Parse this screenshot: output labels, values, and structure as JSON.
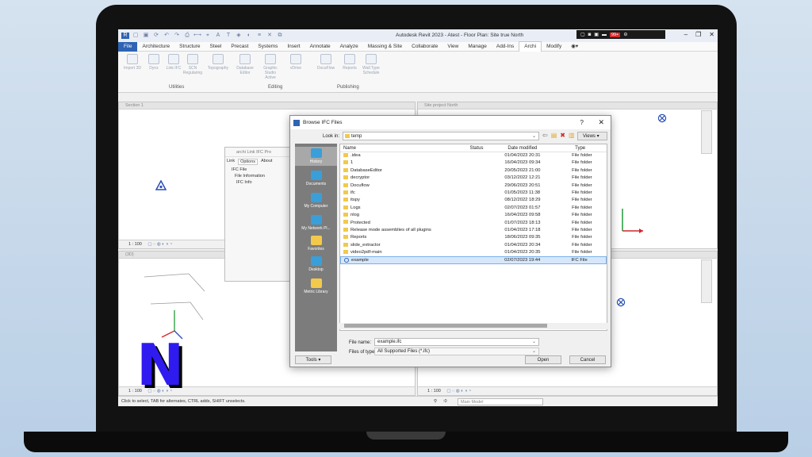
{
  "titlebar": {
    "app_title": "Autodesk Revit 2023 - Atest - Floor Plan: Site true North",
    "overlay_badge": "99+",
    "qat_icons": [
      "revit-logo-icon",
      "open-icon",
      "save-icon",
      "sync-icon",
      "undo-icon",
      "redo-icon",
      "print-icon",
      "measure-icon",
      "dimension-icon",
      "tag-icon",
      "text-icon",
      "3d-icon",
      "section-icon",
      "thin-lines-icon",
      "close-hidden-icon",
      "switch-windows-icon"
    ]
  },
  "ribbon_tabs": [
    "File",
    "Architecture",
    "Structure",
    "Steel",
    "Precast",
    "Systems",
    "Insert",
    "Annotate",
    "Analyze",
    "Massing & Site",
    "Collaborate",
    "View",
    "Manage",
    "Add-Ins",
    "Archi",
    "Modify"
  ],
  "ribbon": {
    "buttons": [
      "Import 3D",
      "Dynz",
      "Link IFC",
      "SCN Regularing",
      "Topography",
      "Database Editor",
      "Graphic Studio Active",
      "vDrive",
      "DocuFlow",
      "Reports",
      "Wall Type Schedule"
    ],
    "groups": [
      "Utilities",
      "Editing",
      "Publishing"
    ]
  },
  "views": {
    "top_left_title": "Section 1",
    "top_right_title": "Site project North",
    "bottom_left_title": "{3D}",
    "scale_left": "1 : 100",
    "scale_right": "1 : 100"
  },
  "status_bar": {
    "hint": "Click to select, TAB for alternates, CTRL adds, SHIFT unselects.",
    "model": "Main Model",
    "zero": ":0"
  },
  "ifc_panel": {
    "title": "archi Link IFC Pro",
    "menu": [
      "Link",
      "Options",
      "About"
    ],
    "tree": [
      "IFC File",
      "File Information",
      "IFC Info"
    ]
  },
  "dialog": {
    "title": "Browse IFC Files",
    "help": "?",
    "close": "✕",
    "look_in_label": "Look in:",
    "look_in_value": "temp",
    "views_label": "Views",
    "places": [
      "History",
      "Documents",
      "My Computer",
      "My Network Pl...",
      "Favorites",
      "Desktop",
      "Metric Library"
    ],
    "columns": {
      "name": "Name",
      "status": "Status",
      "date": "Date modified",
      "type": "Type"
    },
    "files": [
      {
        "name": ".idea",
        "status": "",
        "date": "01/04/2023 20:31",
        "type": "File folder"
      },
      {
        "name": "1",
        "status": "",
        "date": "16/04/2023 09:34",
        "type": "File folder"
      },
      {
        "name": "DatabaseEditor",
        "status": "",
        "date": "20/05/2023 21:00",
        "type": "File folder"
      },
      {
        "name": "decryptor",
        "status": "",
        "date": "03/12/2022 12:21",
        "type": "File folder"
      },
      {
        "name": "Docuflow",
        "status": "",
        "date": "29/06/2023 20:51",
        "type": "File folder"
      },
      {
        "name": "ifc",
        "status": "",
        "date": "01/05/2023 11:38",
        "type": "File folder"
      },
      {
        "name": "itspy",
        "status": "",
        "date": "08/12/2022 18:29",
        "type": "File folder"
      },
      {
        "name": "Logs",
        "status": "",
        "date": "02/07/2023 01:57",
        "type": "File folder"
      },
      {
        "name": "nlog",
        "status": "",
        "date": "16/04/2023 09:58",
        "type": "File folder"
      },
      {
        "name": "Protected",
        "status": "",
        "date": "01/07/2023 18:13",
        "type": "File folder"
      },
      {
        "name": "Release mode assemblies of all plugins",
        "status": "",
        "date": "01/04/2023 17:18",
        "type": "File folder"
      },
      {
        "name": "Reports",
        "status": "",
        "date": "18/06/2023 09:35",
        "type": "File folder"
      },
      {
        "name": "slide_extractor",
        "status": "",
        "date": "01/04/2023 20:34",
        "type": "File folder"
      },
      {
        "name": "video2pdf-main",
        "status": "",
        "date": "01/04/2023 20:35",
        "type": "File folder"
      },
      {
        "name": "example",
        "status": "",
        "date": "02/07/2023 19:44",
        "type": "IFC File"
      }
    ],
    "selected_index": 14,
    "file_name_label": "File name:",
    "file_name_value": "example.ifc",
    "file_type_label": "Files of type:",
    "file_type_value": "All Supported Files (*.ifc)",
    "tools_label": "Tools",
    "open_label": "Open",
    "cancel_label": "Cancel"
  },
  "brand_letter": "N"
}
